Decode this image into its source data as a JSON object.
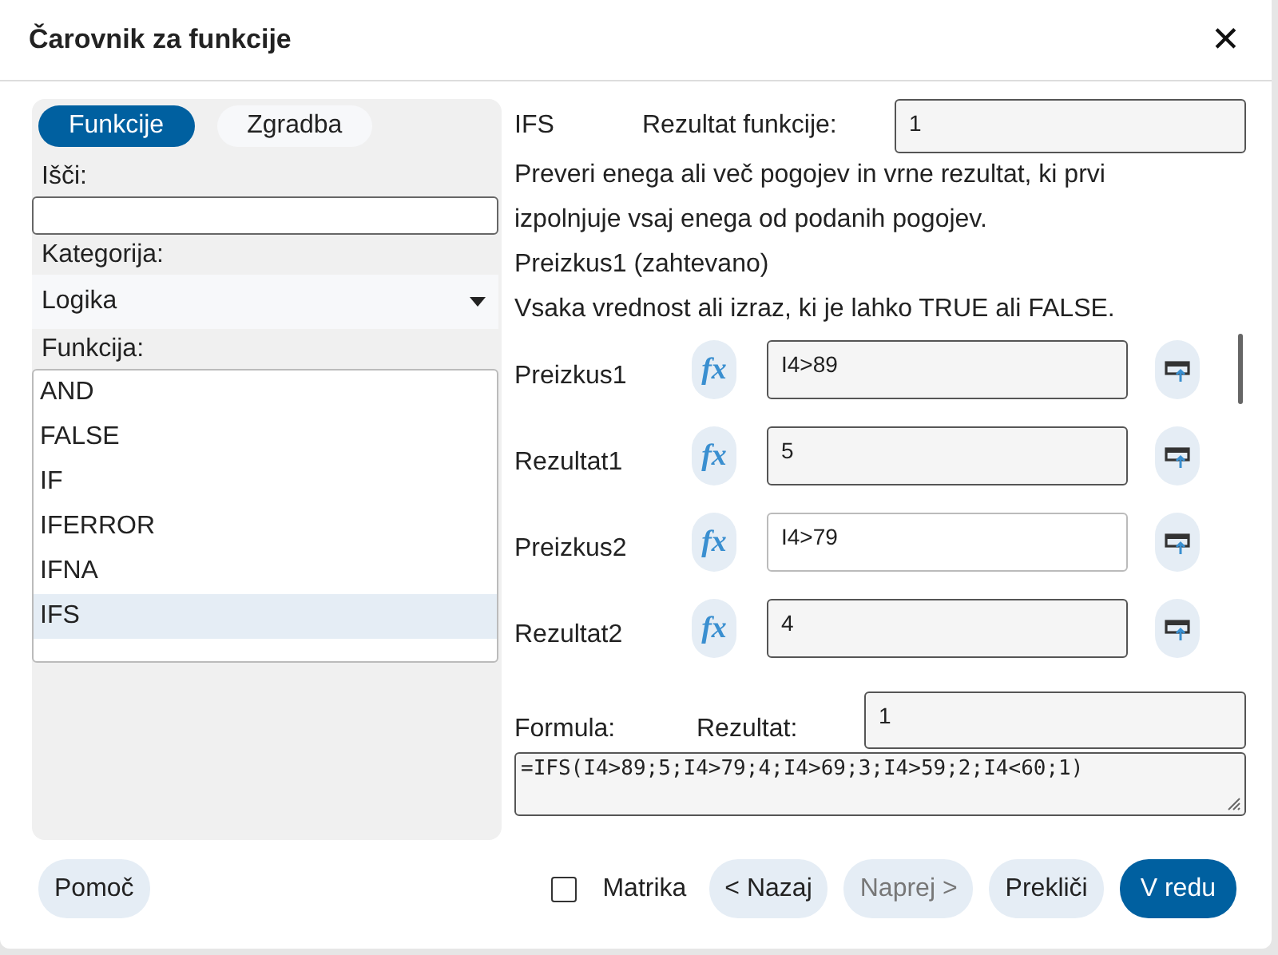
{
  "window": {
    "title": "Čarovnik za funkcije",
    "close": "✕"
  },
  "tabs": [
    {
      "label": "Funkcije",
      "selected": true
    },
    {
      "label": "Zgradba",
      "selected": false
    }
  ],
  "search": {
    "label": "Išči:"
  },
  "category": {
    "label": "Kategorija:",
    "value": "Logika"
  },
  "functions": {
    "label": "Funkcija:",
    "items": [
      {
        "name": "AND",
        "selected": false
      },
      {
        "name": "FALSE",
        "selected": false
      },
      {
        "name": "IF",
        "selected": false
      },
      {
        "name": "IFERROR",
        "selected": false
      },
      {
        "name": "IFNA",
        "selected": false
      },
      {
        "name": "IFS",
        "selected": true
      }
    ]
  },
  "function_name": "IFS",
  "function_result_label": "Rezultat funkcije:",
  "function_result": "1",
  "description": "Preveri enega ali več pogojev in vrne rezultat, ki prvi izpolnjuje vsaj enega od podanih pogojev.",
  "argument_title": "Preizkus1 (zahtevano)",
  "argument_description": "Vsaka vrednost ali izraz, ki je lahko TRUE ali FALSE.",
  "arguments": [
    {
      "label": "Preizkus1",
      "fx_button": "fx",
      "value": "I4>89",
      "selected": false
    },
    {
      "label": "Rezultat1",
      "fx_button": "fx",
      "value": "5",
      "selected": false
    },
    {
      "label": "Preizkus2",
      "fx_button": "fx",
      "value": "I4>79",
      "selected": true
    },
    {
      "label": "Rezultat2",
      "fx_button": "fx",
      "value": "4",
      "selected": false
    }
  ],
  "formula_label": "Formula:",
  "result_label": "Rezultat:",
  "result": "1",
  "formula": "=IFS(I4>89;5;I4>79;4;I4>69;3;I4>59;2;I4<60;1)",
  "help_button": "Pomoč",
  "array": {
    "label": "Matrika",
    "checked": false
  },
  "buttons": [
    {
      "label": "< Nazaj",
      "disabled": false,
      "kind": "normal"
    },
    {
      "label": "Naprej >",
      "disabled": true,
      "kind": "normal"
    },
    {
      "label": "Prekliči",
      "disabled": false,
      "kind": "normal"
    },
    {
      "label": "V redu",
      "disabled": false,
      "kind": "primary"
    }
  ]
}
